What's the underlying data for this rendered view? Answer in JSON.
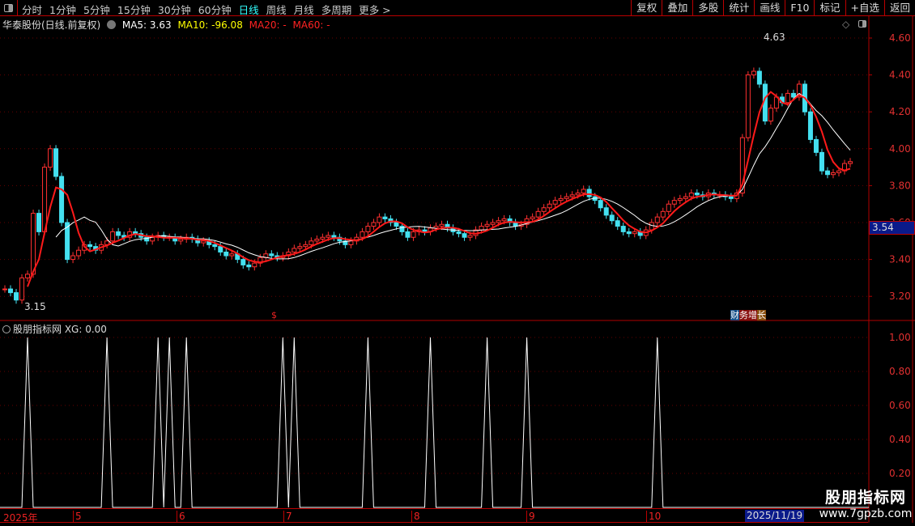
{
  "topbar": {
    "periods": [
      "分时",
      "1分钟",
      "5分钟",
      "15分钟",
      "30分钟",
      "60分钟",
      "日线",
      "周线",
      "月线",
      "多周期",
      "更多 >"
    ],
    "active_period": "日线",
    "tools": [
      "复权",
      "叠加",
      "多股",
      "统计",
      "画线",
      "F10",
      "标记",
      "+自选",
      "返回"
    ]
  },
  "info": {
    "title": "华泰股份(日线.前复权)",
    "ma5": "MA5: 3.63",
    "ma10": "MA10: -96.08",
    "ma20": "MA20: -",
    "ma60": "MA60: -"
  },
  "colors": {
    "up": "#ff3030",
    "down": "#44e0f0",
    "ma_red": "#ff1a1a",
    "ma_white": "#ffffff",
    "grid": "#b00000",
    "axis_text": "#e03030",
    "highlight": "#0a1a8a"
  },
  "price_axis": {
    "ticks": [
      "4.60",
      "4.40",
      "4.20",
      "4.00",
      "3.80",
      "3.60",
      "3.40",
      "3.20"
    ],
    "current": "3.54"
  },
  "annotations": {
    "high": "4.63",
    "low": "3.15",
    "signal_s": "$",
    "signal_cw": [
      "财",
      "务",
      "增",
      "长"
    ]
  },
  "indicator": {
    "header": "股朋指标网 XG: 0.00",
    "ticks": [
      "1.00",
      "0.80",
      "0.60",
      "0.40",
      "0.20"
    ]
  },
  "date_axis": {
    "labels": [
      "2025年",
      "5",
      "6",
      "7",
      "8",
      "9",
      "10"
    ],
    "current": "2025/11/19"
  },
  "watermark": {
    "title": "股朋指标网",
    "url": "www.7gpzb.com"
  },
  "chart_data": {
    "type": "candlestick",
    "ylim": [
      3.1,
      4.7
    ],
    "closes": [
      3.24,
      3.22,
      3.18,
      3.3,
      3.32,
      3.65,
      3.55,
      3.9,
      4.0,
      3.85,
      3.6,
      3.4,
      3.42,
      3.45,
      3.48,
      3.47,
      3.45,
      3.48,
      3.5,
      3.55,
      3.53,
      3.52,
      3.55,
      3.54,
      3.52,
      3.5,
      3.52,
      3.53,
      3.52,
      3.52,
      3.5,
      3.51,
      3.52,
      3.51,
      3.49,
      3.5,
      3.48,
      3.47,
      3.44,
      3.42,
      3.43,
      3.4,
      3.37,
      3.36,
      3.38,
      3.41,
      3.43,
      3.42,
      3.41,
      3.42,
      3.44,
      3.46,
      3.47,
      3.48,
      3.5,
      3.51,
      3.52,
      3.53,
      3.52,
      3.5,
      3.48,
      3.5,
      3.52,
      3.55,
      3.58,
      3.6,
      3.63,
      3.62,
      3.6,
      3.58,
      3.55,
      3.52,
      3.55,
      3.56,
      3.55,
      3.57,
      3.58,
      3.59,
      3.57,
      3.55,
      3.54,
      3.52,
      3.53,
      3.56,
      3.58,
      3.59,
      3.6,
      3.61,
      3.62,
      3.6,
      3.58,
      3.59,
      3.62,
      3.63,
      3.66,
      3.68,
      3.7,
      3.72,
      3.73,
      3.74,
      3.75,
      3.76,
      3.78,
      3.74,
      3.72,
      3.68,
      3.64,
      3.61,
      3.58,
      3.55,
      3.54,
      3.55,
      3.53,
      3.56,
      3.6,
      3.63,
      3.66,
      3.7,
      3.72,
      3.73,
      3.74,
      3.76,
      3.75,
      3.74,
      3.76,
      3.75,
      3.75,
      3.74,
      3.73,
      3.76,
      4.06,
      4.4,
      4.42,
      4.35,
      4.15,
      4.22,
      4.28,
      4.25,
      4.3,
      4.28,
      4.35,
      4.2,
      4.05,
      3.98,
      3.88,
      3.86,
      3.87,
      3.88,
      3.92,
      3.93
    ],
    "xg_signal_bars": [
      4,
      18,
      27,
      29,
      32,
      49,
      51,
      64,
      75,
      85,
      92,
      115
    ],
    "xg_ylim": [
      0,
      1.05
    ]
  }
}
